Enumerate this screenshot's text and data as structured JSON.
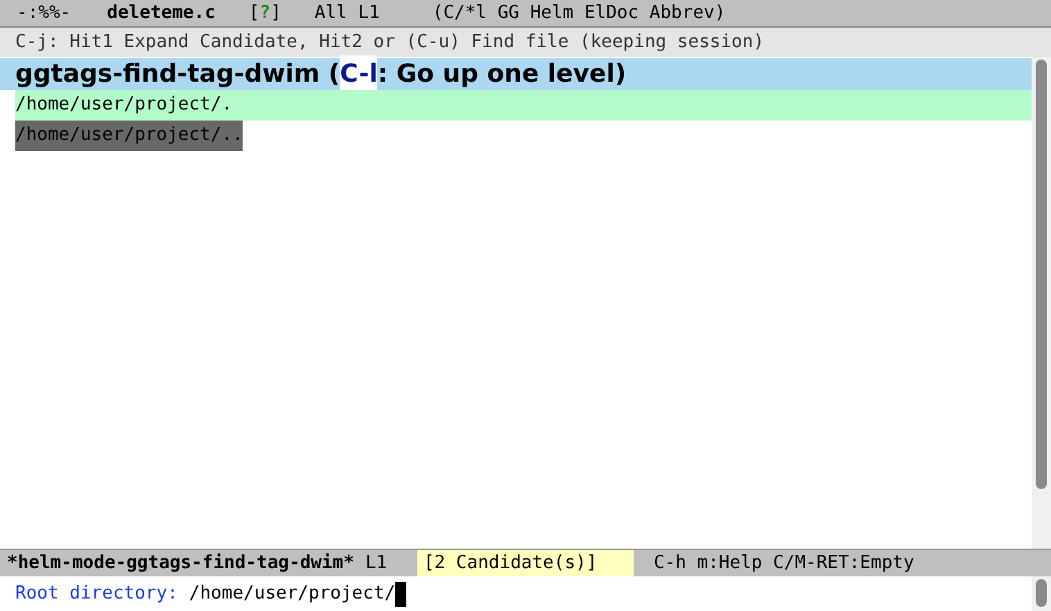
{
  "top_mode_line": {
    "status": "-:%%-",
    "buffer_name": "deleteme.c",
    "flag_open": "[",
    "flag": "?",
    "flag_close": "]",
    "position": "All L1",
    "modes": "(C/*l GG Helm ElDoc Abbrev)"
  },
  "header_line": "C-j: Hit1 Expand Candidate, Hit2 or (C-u) Find file (keeping session)",
  "helm": {
    "source_title": "ggtags-find-tag-dwim",
    "title_open": " (",
    "key": "C-l",
    "title_rest": ": Go up one level)",
    "candidates": [
      {
        "text": "/home/user/project/.",
        "selected": true,
        "kind": "dir"
      },
      {
        "text": "/home/user/project/..",
        "selected": false,
        "kind": "dotted"
      }
    ]
  },
  "mode_line": {
    "buffer_name": "*helm-mode-ggtags-find-tag-dwim*",
    "position": "L1",
    "count": "[2 Candidate(s)]",
    "help": "C-h m:Help C/M-RET:Empty"
  },
  "minibuffer": {
    "prompt": "Root directory:",
    "input": "/home/user/project/"
  }
}
